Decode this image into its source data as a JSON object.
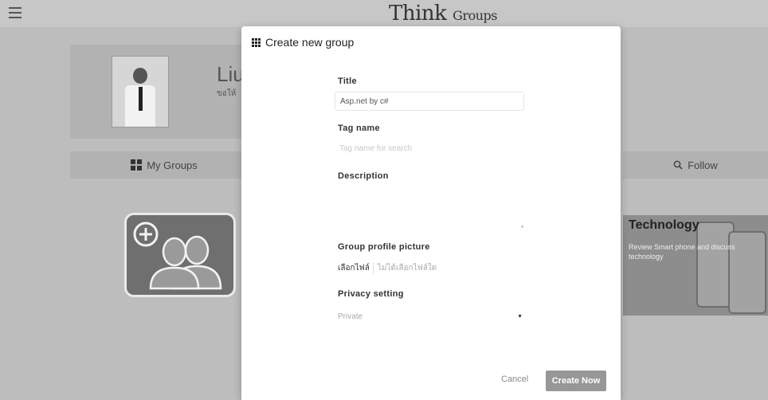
{
  "app": {
    "brand_main": "Think",
    "brand_sub": "Groups",
    "menu_icon": "hamburger-menu-icon"
  },
  "profile": {
    "name": "Liu",
    "subtitle": "ขอให้"
  },
  "tabs": {
    "my_groups": "My Groups",
    "follow": "Follow"
  },
  "groups": [
    {
      "title": "Technology",
      "description": "Review Smart phone and discuss technology"
    }
  ],
  "modal": {
    "title": "Create new group",
    "fields": {
      "title_label": "Title",
      "title_value": "Asp.net by c#",
      "tag_label": "Tag name",
      "tag_placeholder": "Tag name for search",
      "description_label": "Description",
      "picture_label": "Group profile picture",
      "file_button": "เลือกไฟล์",
      "file_status": "ไม่ได้เลือกไฟล์ใด",
      "privacy_label": "Privacy setting",
      "privacy_value": "Private"
    },
    "buttons": {
      "cancel": "Cancel",
      "create": "Create Now"
    }
  }
}
